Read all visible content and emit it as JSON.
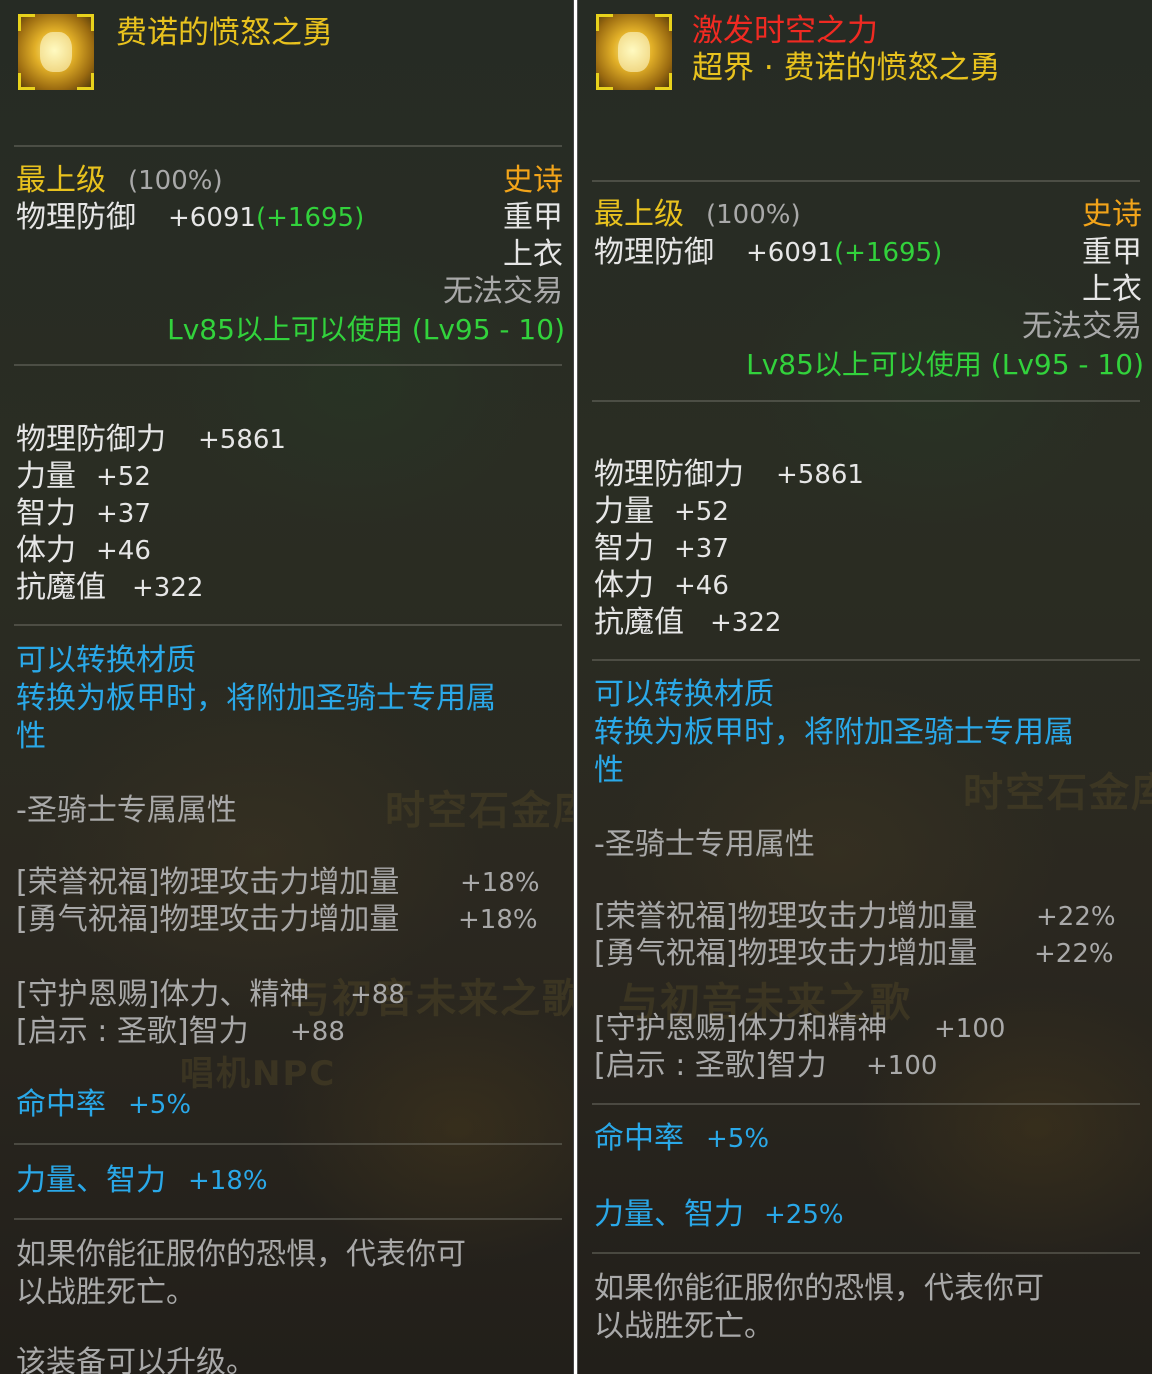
{
  "left": {
    "title": "费诺的愤怒之勇",
    "grade": "最上级",
    "grade_percent": "(100%)",
    "rarity": "史诗",
    "phys_def_label": "物理防御",
    "phys_def_value": "+6091",
    "phys_def_bonus": "(+1695)",
    "armor_type": "重甲",
    "slot": "上衣",
    "trade": "无法交易",
    "level_req": "Lv85以上可以使用 (Lv95 - 10)",
    "stats": [
      {
        "name": "物理防御力",
        "value": "+5861"
      },
      {
        "name": "力量",
        "value": "+52"
      },
      {
        "name": "智力",
        "value": "+37"
      },
      {
        "name": "体力",
        "value": "+46"
      },
      {
        "name": "抗魔值",
        "value": "+322"
      }
    ],
    "convert_line1": "可以转换材质",
    "convert_line2": "转换为板甲时，将附加圣骑士专用属",
    "convert_line3": "性",
    "class_header": "-圣骑士专属属性",
    "skills": [
      {
        "name": "[荣誉祝福]物理攻击力增加量",
        "value": "+18%"
      },
      {
        "name": "[勇气祝福]物理攻击力增加量",
        "value": "+18%"
      },
      {
        "name": "[守护恩赐]体力、精神",
        "value": "+88"
      },
      {
        "name": "[启示 : 圣歌]智力",
        "value": "+88"
      }
    ],
    "hit_label": "命中率",
    "hit_value": "+5%",
    "str_int_label": "力量、智力",
    "str_int_value": "+18%",
    "flavor_line1": "如果你能征服你的恐惧，代表你可",
    "flavor_line2": "以战胜死亡。",
    "upgrade_note": "该装备可以升级。",
    "watermark1": "时空石金库",
    "watermark2": "与初音未来之歌",
    "watermark3": "唱机NPC"
  },
  "right": {
    "title_red": "激发时空之力",
    "title": "超界 · 费诺的愤怒之勇",
    "grade": "最上级",
    "grade_percent": "(100%)",
    "rarity": "史诗",
    "phys_def_label": "物理防御",
    "phys_def_value": "+6091",
    "phys_def_bonus": "(+1695)",
    "armor_type": "重甲",
    "slot": "上衣",
    "trade": "无法交易",
    "level_req": "Lv85以上可以使用 (Lv95 - 10)",
    "stats": [
      {
        "name": "物理防御力",
        "value": "+5861"
      },
      {
        "name": "力量",
        "value": "+52"
      },
      {
        "name": "智力",
        "value": "+37"
      },
      {
        "name": "体力",
        "value": "+46"
      },
      {
        "name": "抗魔值",
        "value": "+322"
      }
    ],
    "convert_line1": "可以转换材质",
    "convert_line2": "转换为板甲时，将附加圣骑士专用属",
    "convert_line3": "性",
    "class_header": "-圣骑士专用属性",
    "skills": [
      {
        "name": "[荣誉祝福]物理攻击力增加量",
        "value": "+22%"
      },
      {
        "name": "[勇气祝福]物理攻击力增加量",
        "value": "+22%"
      },
      {
        "name": "[守护恩赐]体力和精神",
        "value": "+100"
      },
      {
        "name": "[启示 : 圣歌]智力",
        "value": "+100"
      }
    ],
    "hit_label": "命中率",
    "hit_value": "+5%",
    "str_int_label": "力量、智力",
    "str_int_value": "+25%",
    "flavor_line1": "如果你能征服你的恐惧，代表你可",
    "flavor_line2": "以战胜死亡。",
    "watermark1": "时空石金库",
    "watermark2": "与初音未来之歌"
  }
}
